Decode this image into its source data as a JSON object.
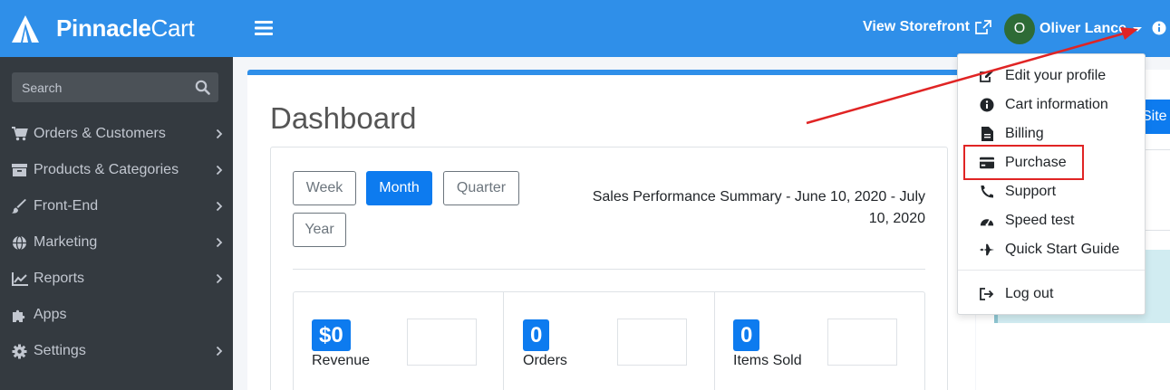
{
  "brand": {
    "name_bold": "Pinnacle",
    "name_light": "Cart"
  },
  "search": {
    "placeholder": "Search"
  },
  "sidebar": {
    "items": [
      {
        "label": "Orders & Customers",
        "icon": "cart-icon"
      },
      {
        "label": "Products & Categories",
        "icon": "archive-icon"
      },
      {
        "label": "Front-End",
        "icon": "brush-icon"
      },
      {
        "label": "Marketing",
        "icon": "globe-icon"
      },
      {
        "label": "Reports",
        "icon": "chart-icon"
      },
      {
        "label": "Apps",
        "icon": "puzzle-icon"
      },
      {
        "label": "Settings",
        "icon": "gear-icon"
      }
    ]
  },
  "topbar": {
    "storefront_label": "View Storefront",
    "user_initial": "O",
    "user_name": "Oliver Lance"
  },
  "dashboard": {
    "title": "Dashboard",
    "periods": [
      "Week",
      "Month",
      "Quarter",
      "Year"
    ],
    "active_period": "Month",
    "summary": "Sales Performance Summary - June 10, 2020 - July 10, 2020",
    "stats": [
      {
        "value": "$0",
        "label": "Revenue"
      },
      {
        "value": "0",
        "label": "Orders"
      },
      {
        "value": "0",
        "label": "Items Sold"
      }
    ]
  },
  "side": {
    "button_label": "Site"
  },
  "dropdown": {
    "items": [
      {
        "label": "Edit your profile",
        "icon": "edit-icon"
      },
      {
        "label": "Cart information",
        "icon": "info-icon"
      },
      {
        "label": "Billing",
        "icon": "file-icon"
      },
      {
        "label": "Purchase",
        "icon": "credit-card-icon"
      },
      {
        "label": "Support",
        "icon": "phone-icon"
      },
      {
        "label": "Speed test",
        "icon": "speedometer-icon"
      },
      {
        "label": "Quick Start Guide",
        "icon": "plane-icon"
      }
    ],
    "logout_label": "Log out"
  },
  "colors": {
    "primary": "#2f8fe9",
    "button_blue": "#0d7bef",
    "sidebar": "#343a40",
    "annotation_red": "#e02424"
  }
}
